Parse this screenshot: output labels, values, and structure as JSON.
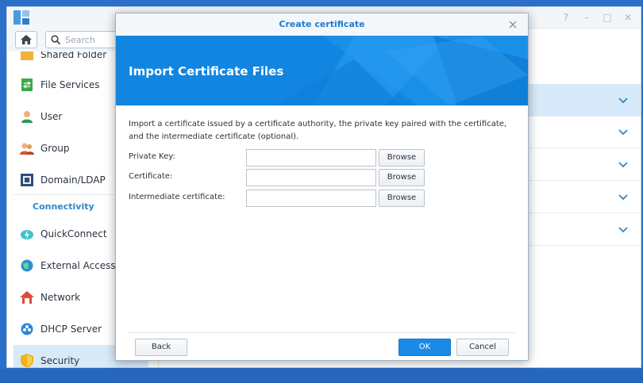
{
  "sidebar": {
    "partial_item": "Shared Folder",
    "items": [
      {
        "label": "File Services",
        "icon": "file-services-icon"
      },
      {
        "label": "User",
        "icon": "user-icon"
      },
      {
        "label": "Group",
        "icon": "group-icon"
      },
      {
        "label": "Domain/LDAP",
        "icon": "domain-ldap-icon"
      },
      {
        "label": "QuickConnect",
        "icon": "quickconnect-icon"
      },
      {
        "label": "External Access",
        "icon": "external-access-icon"
      },
      {
        "label": "Network",
        "icon": "network-icon"
      },
      {
        "label": "DHCP Server",
        "icon": "dhcp-server-icon"
      },
      {
        "label": "Security",
        "icon": "security-icon"
      }
    ],
    "section_connectivity": "Connectivity"
  },
  "search": {
    "placeholder": "Search"
  },
  "window_controls": [
    "?",
    "–",
    "□",
    "✕"
  ],
  "dialog": {
    "title": "Create certificate",
    "banner_title": "Import Certificate Files",
    "intro": "Import a certificate issued by a certificate authority, the private key paired with the certificate, and the intermediate certificate (optional).",
    "fields": [
      {
        "label": "Private Key:",
        "value": "",
        "button": "Browse"
      },
      {
        "label": "Certificate:",
        "value": "",
        "button": "Browse"
      },
      {
        "label": "Intermediate certificate:",
        "value": "",
        "button": "Browse"
      }
    ],
    "buttons": {
      "back": "Back",
      "ok": "OK",
      "cancel": "Cancel"
    }
  },
  "colors": {
    "accent": "#1185e0",
    "active_row": "#d8eaf9",
    "section": "#2f86c8"
  }
}
